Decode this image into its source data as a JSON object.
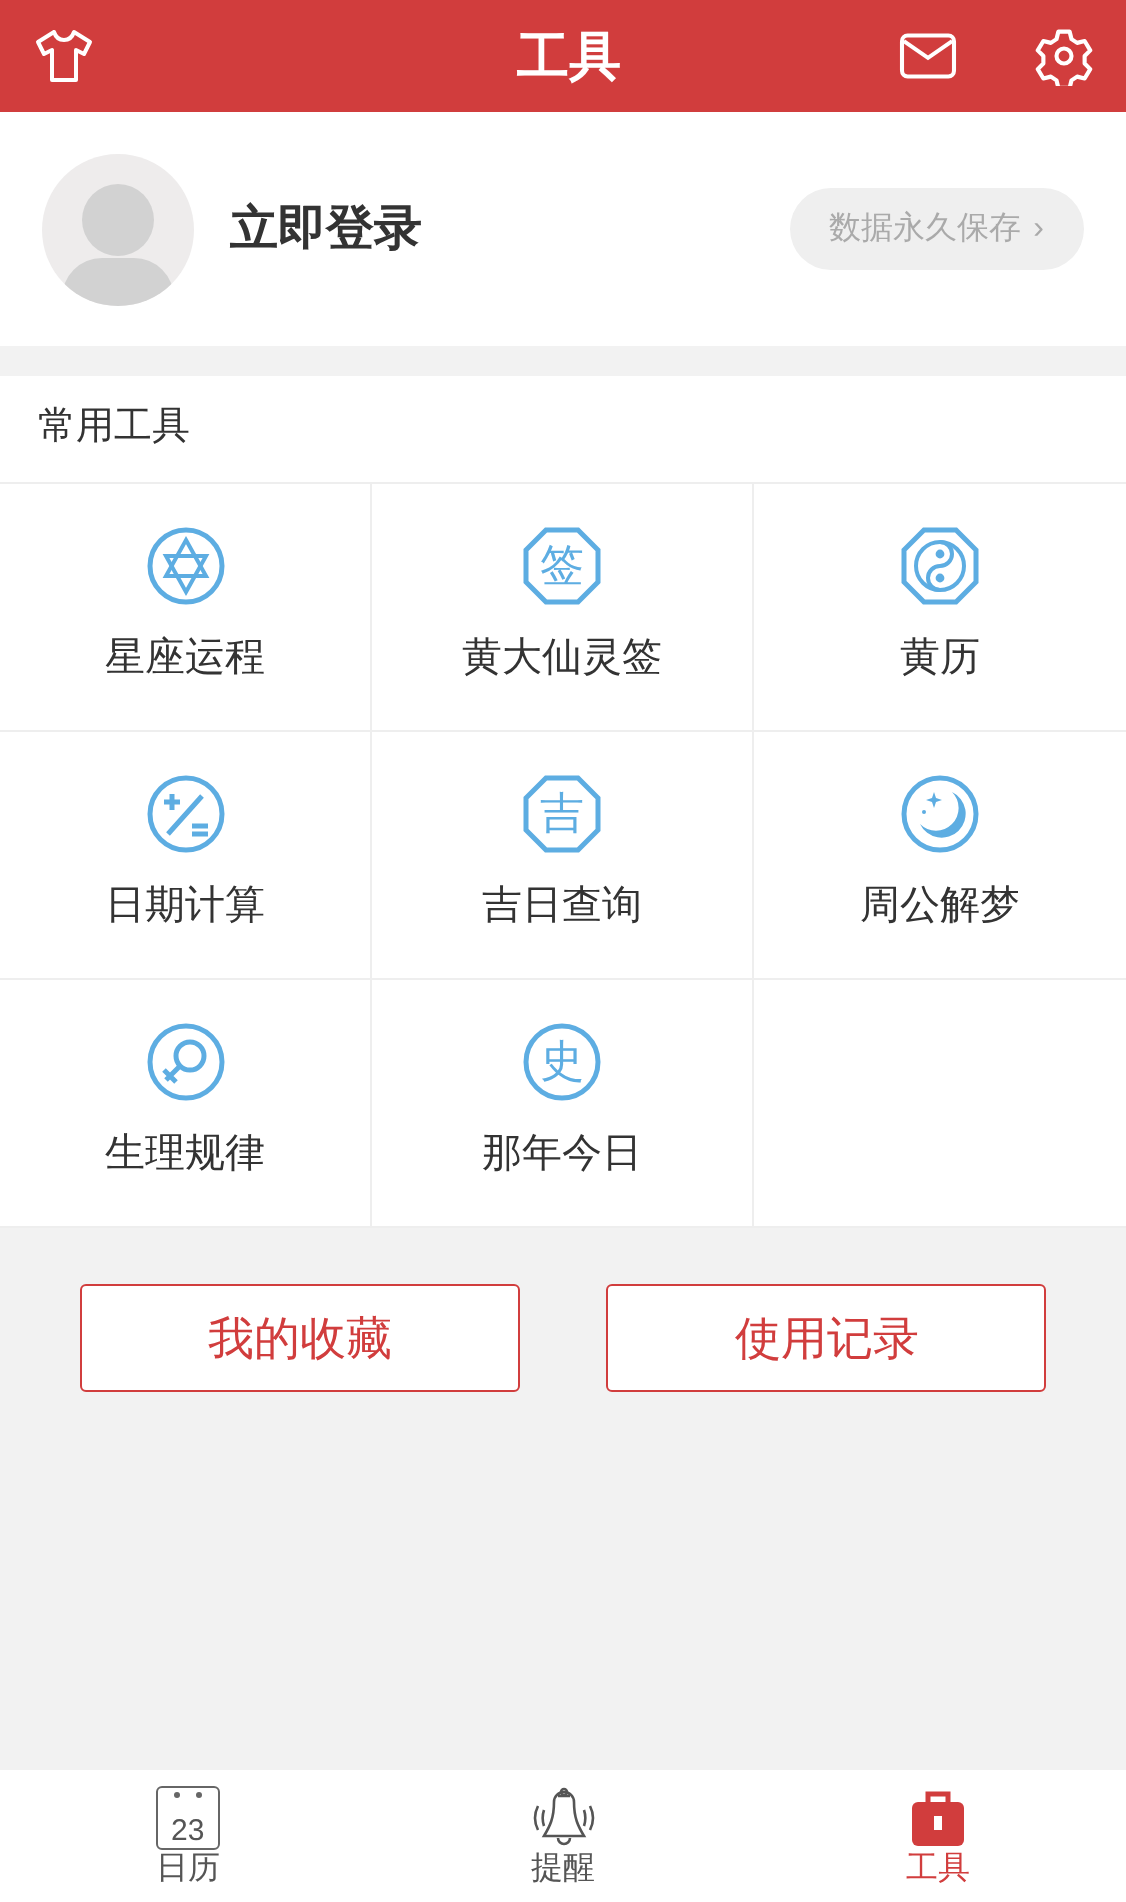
{
  "header": {
    "title": "工具"
  },
  "profile": {
    "login": "立即登录",
    "save_button": "数据永久保存",
    "chevron": "›"
  },
  "section": {
    "title": "常用工具"
  },
  "tools": [
    {
      "label": "星座运程"
    },
    {
      "label": "黄大仙灵签",
      "glyph": "签"
    },
    {
      "label": "黄历"
    },
    {
      "label": "日期计算"
    },
    {
      "label": "吉日查询",
      "glyph": "吉"
    },
    {
      "label": "周公解梦"
    },
    {
      "label": "生理规律"
    },
    {
      "label": "那年今日",
      "glyph": "史"
    }
  ],
  "actions": [
    "我的收藏",
    "使用记录"
  ],
  "tab_bar": [
    {
      "label": "日历",
      "icon_text": "23",
      "selected": false
    },
    {
      "label": "提醒",
      "selected": false
    },
    {
      "label": "工具",
      "selected": true
    }
  ]
}
